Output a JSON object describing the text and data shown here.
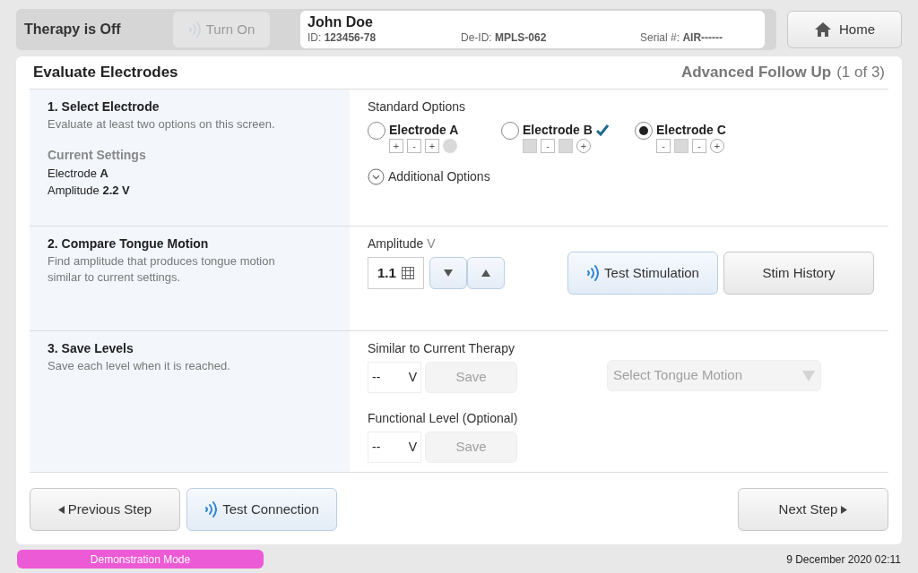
{
  "top_bar": {
    "therapy_status": "Therapy is Off",
    "turn_on": {
      "label": "Turn On",
      "disabled": true
    },
    "patient": {
      "name": "John Doe",
      "fields": [
        {
          "label": "ID:",
          "value": "123456-78"
        },
        {
          "label": "De-ID:",
          "value": "MPLS-062"
        },
        {
          "label": "Serial #:",
          "value": "AIR------"
        }
      ]
    },
    "home": "Home"
  },
  "header": {
    "title": "Evaluate Electrodes",
    "workflow": "Advanced Follow Up",
    "step": "(1 of 3)"
  },
  "steps": [
    {
      "title": "1. Select Electrode",
      "description": "Evaluate at least two options on this screen.",
      "settings_title": "Current Settings",
      "settings": [
        "Electrode **A**",
        "Amplitude **2.2 V**"
      ]
    },
    {
      "title": "2. Compare Tongue Motion",
      "description": "Find amplitude that produces tongue motion similar to current settings."
    },
    {
      "title": "3. Save Levels",
      "description": "Save each level when it is reached."
    }
  ],
  "electrodes": {
    "label": "Standard Options",
    "options": [
      {
        "name": "Electrode A",
        "selected": false,
        "evaluated": false,
        "contacts": [
          {
            "kind": "square",
            "symbol": "+"
          },
          {
            "kind": "square",
            "symbol": "-"
          },
          {
            "kind": "square",
            "symbol": "+"
          },
          {
            "kind": "dot"
          }
        ]
      },
      {
        "name": "Electrode B",
        "selected": false,
        "evaluated": true,
        "contacts": [
          {
            "kind": "blank"
          },
          {
            "kind": "square",
            "symbol": "-"
          },
          {
            "kind": "blank"
          },
          {
            "kind": "ring",
            "symbol": "+"
          }
        ]
      },
      {
        "name": "Electrode C",
        "selected": true,
        "evaluated": false,
        "contacts": [
          {
            "kind": "square",
            "symbol": "-"
          },
          {
            "kind": "blank"
          },
          {
            "kind": "square",
            "symbol": "-"
          },
          {
            "kind": "ring",
            "symbol": "+"
          }
        ]
      }
    ],
    "additional": {
      "label": "Additional Options",
      "expanded": false
    }
  },
  "amplitude": {
    "label": "Amplitude",
    "unit": "V",
    "value": "1.1",
    "test_button": "Test Stimulation",
    "history_button": "Stim History"
  },
  "levels": [
    {
      "label": "Similar to Current Therapy",
      "value": "--",
      "unit": "V",
      "save": "Save",
      "save_disabled": true
    },
    {
      "label": "Functional Level (Optional)",
      "value": "--",
      "unit": "V",
      "save": "Save",
      "save_disabled": true
    }
  ],
  "tongue_motion": {
    "placeholder": "Select Tongue Motion",
    "disabled": true
  },
  "footer_buttons": {
    "previous": "Previous Step",
    "test_connection": "Test Connection",
    "next": "Next Step"
  },
  "status_bar": {
    "mode": "Demonstration Mode",
    "datetime": "9 December 2020 02:11"
  }
}
